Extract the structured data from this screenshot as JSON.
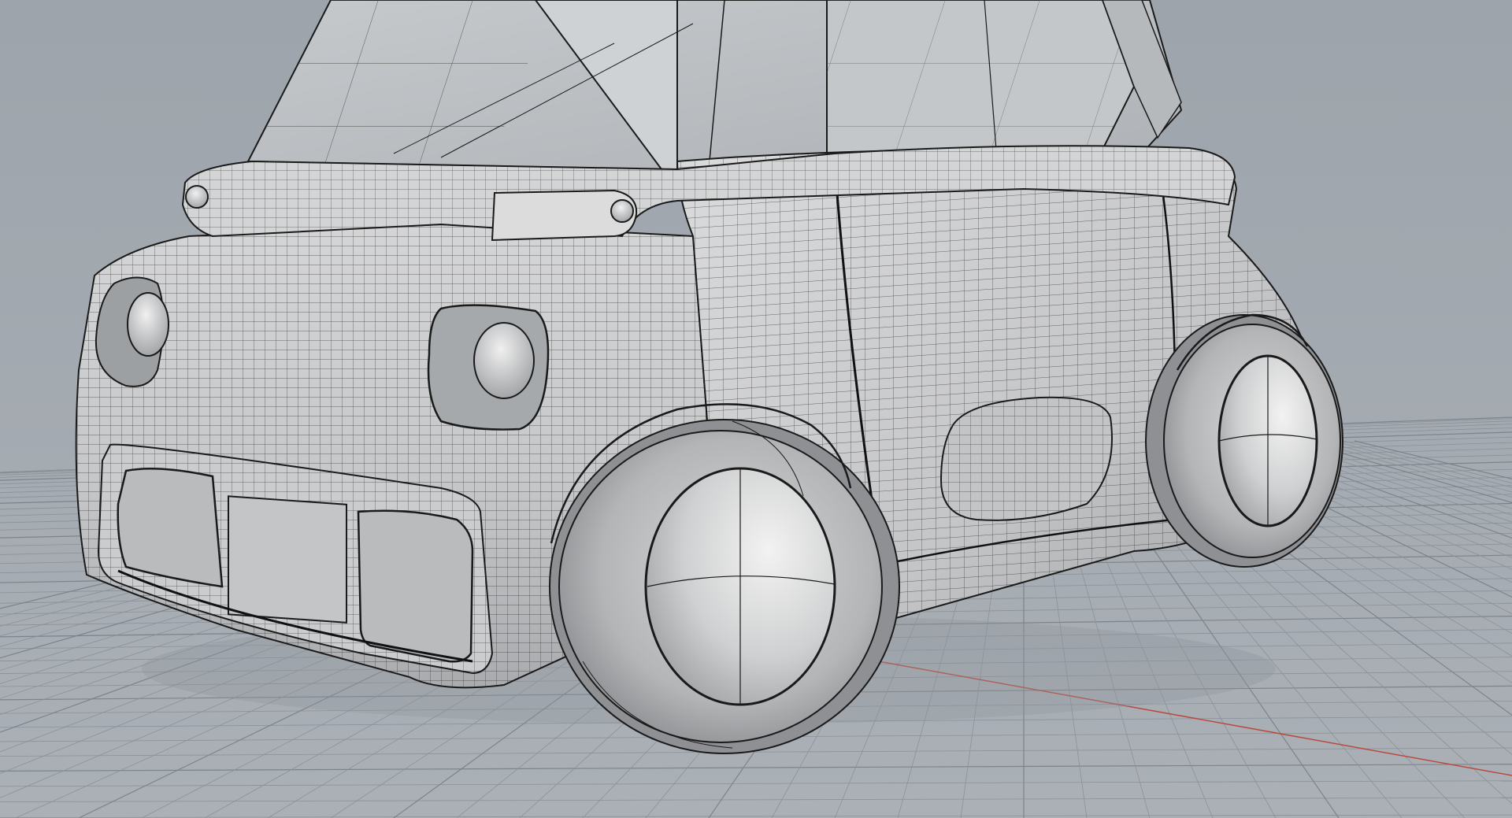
{
  "viewport": {
    "background_top": "#9da4ab",
    "background_bottom": "#a9afb5",
    "grid_color": "#8a9198",
    "grid_major_color": "#7c838a",
    "axis_x_color": "#c0392b",
    "axis_y_color": "#27ae60",
    "display_mode": "shaded-wireframe",
    "object_icon": "car-model-icon"
  },
  "model": {
    "surface_color": "#c9cacc",
    "surface_highlight": "#e6e6e6",
    "surface_shadow": "#8f9194",
    "isocurve_color": "#1a1a1a",
    "glass_color": "#b9bcbf"
  }
}
